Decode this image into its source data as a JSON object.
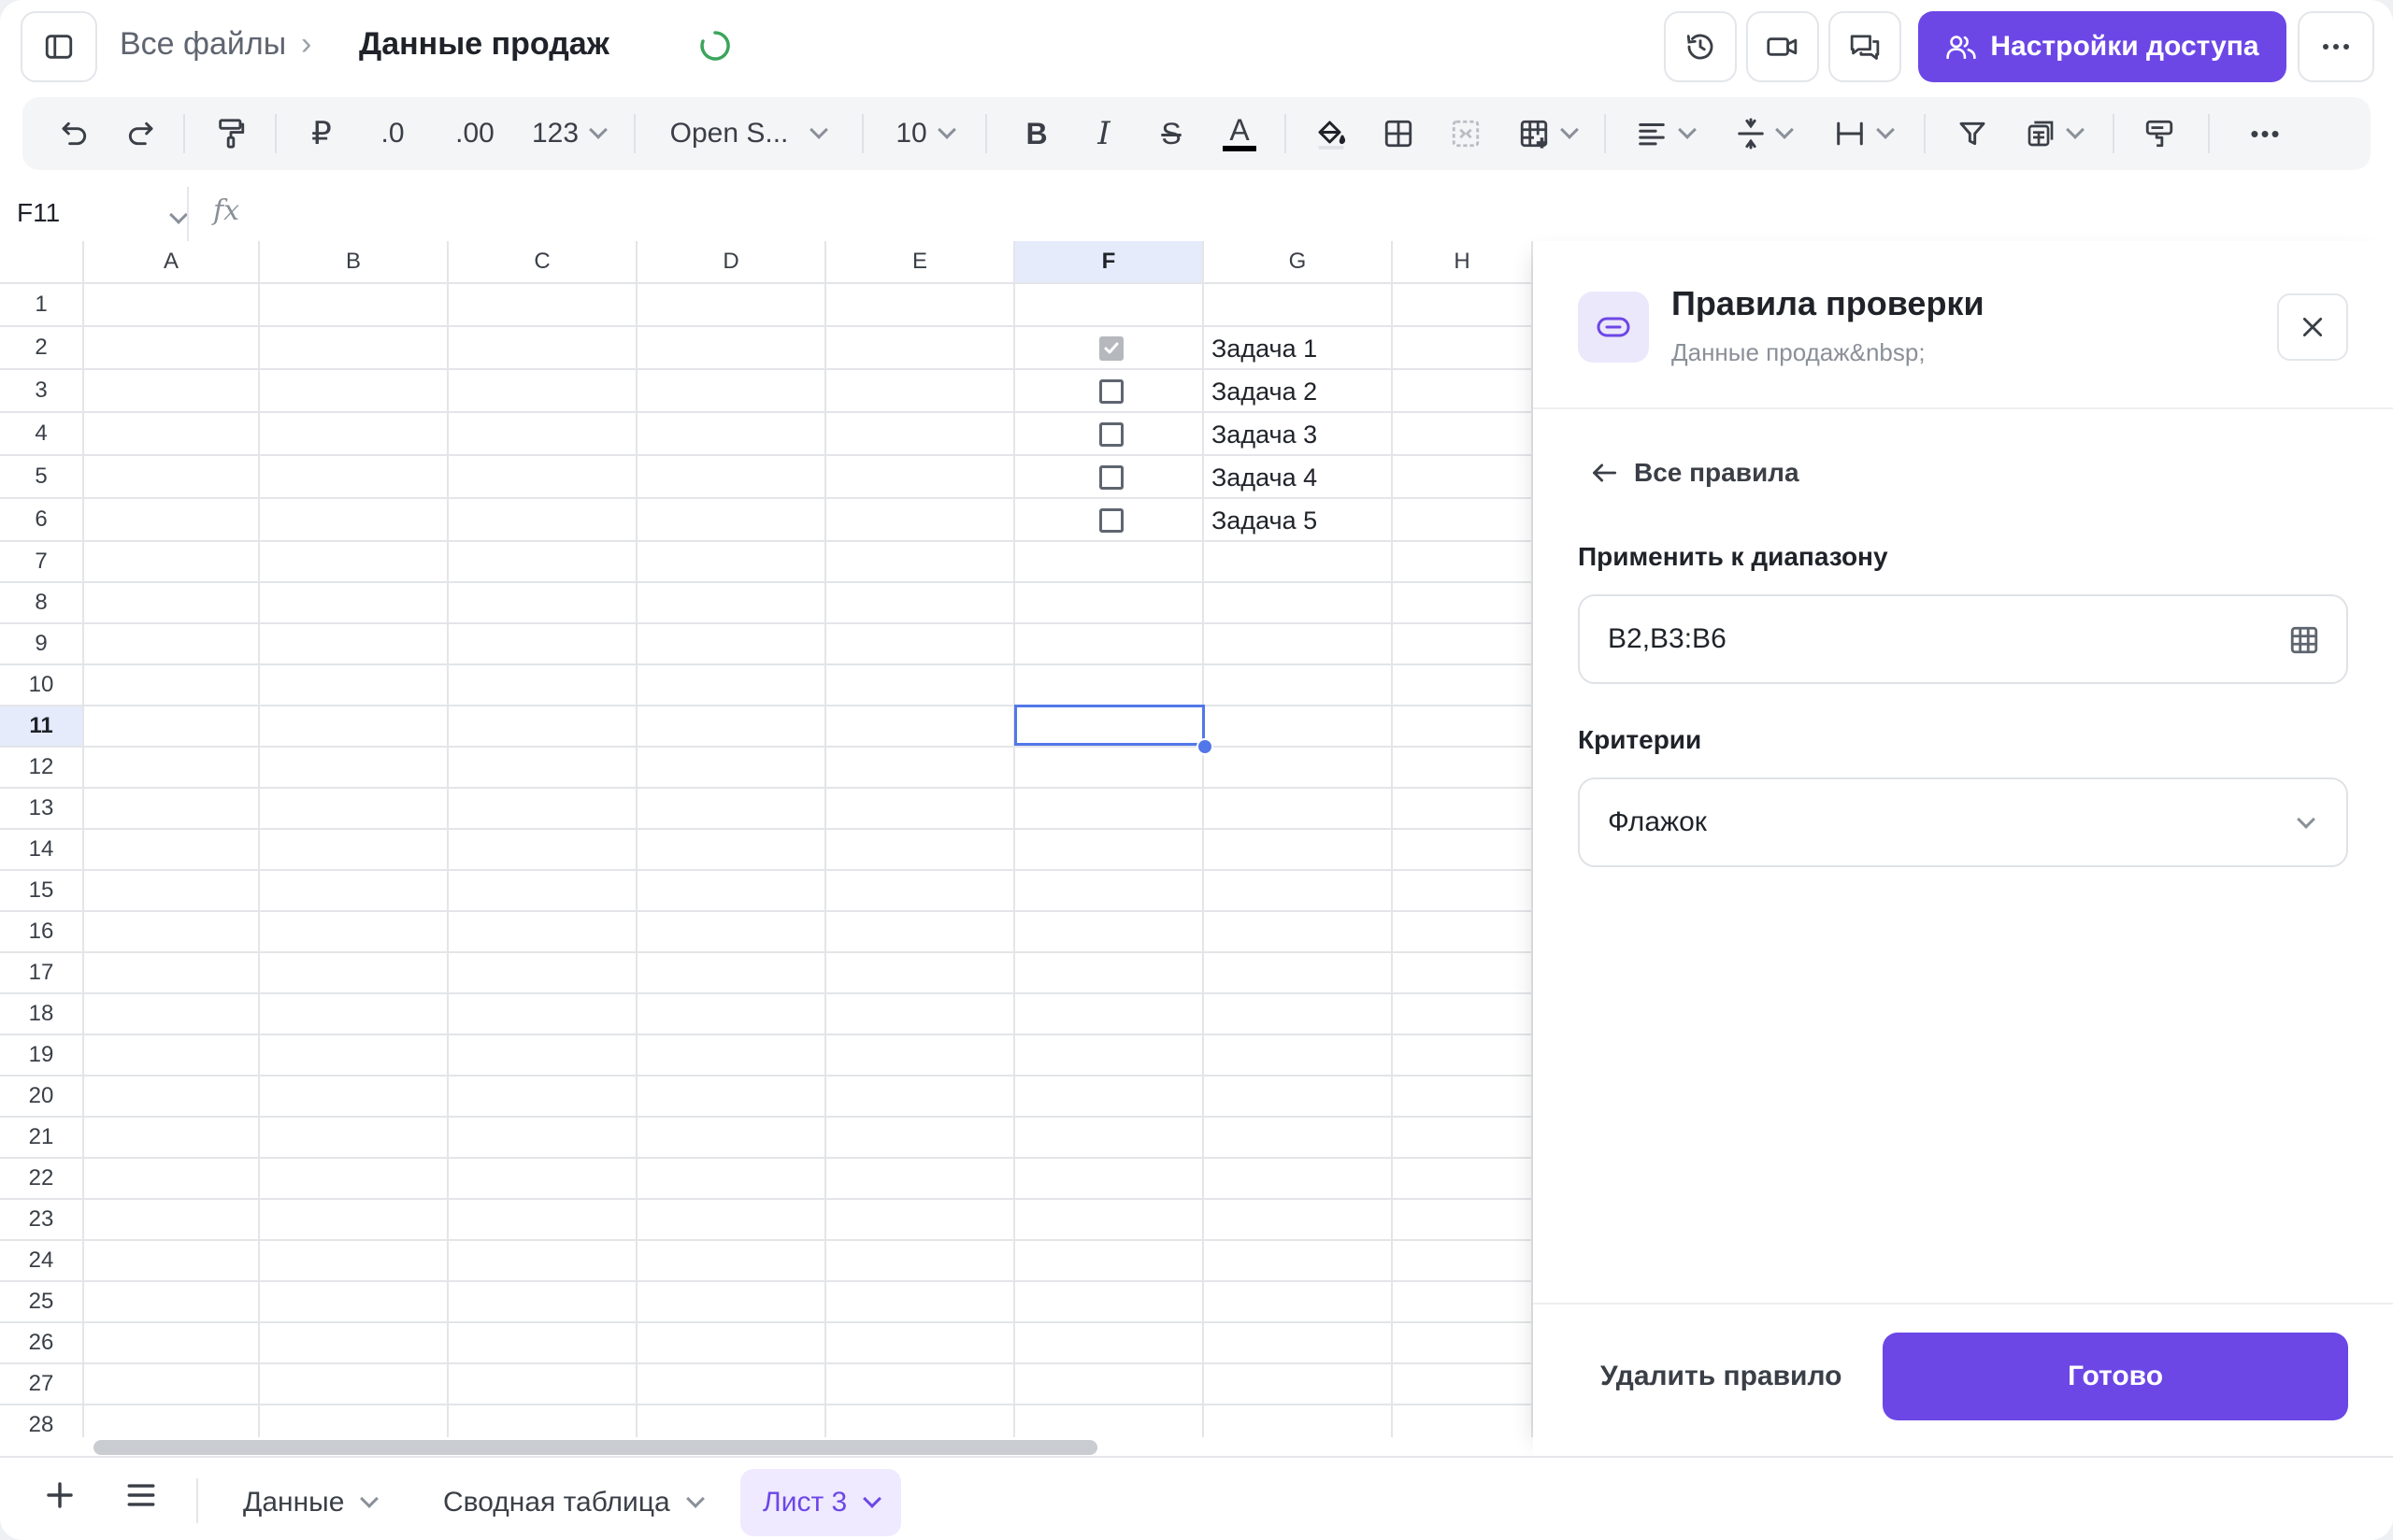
{
  "header": {
    "breadcrumb_root": "Все файлы",
    "breadcrumb_sep": "›",
    "document_title": "Данные продаж",
    "share_button": "Настройки доступа",
    "icons": [
      "sidebar-toggle-icon",
      "history-icon",
      "video-icon",
      "comments-icon",
      "more-icon"
    ]
  },
  "toolbar": {
    "currency": "₽",
    "decrease_decimals": ".0",
    "increase_decimals": ".00",
    "number_format": "123",
    "font": "Open S...",
    "font_size": "10",
    "bold": "B",
    "italic": "I",
    "strike": "S",
    "text_color": "A",
    "more": "•••"
  },
  "formula_bar": {
    "cell_ref": "F11",
    "fx": "fx",
    "value": ""
  },
  "sheet": {
    "columns": [
      "A",
      "B",
      "C",
      "D",
      "E",
      "F",
      "G",
      "H"
    ],
    "selected_column": "F",
    "rows": [
      "1",
      "2",
      "3",
      "4",
      "5",
      "6",
      "7",
      "8",
      "9",
      "10",
      "11",
      "12",
      "13",
      "14",
      "15",
      "16",
      "17",
      "18",
      "19",
      "20",
      "21",
      "22",
      "23",
      "24",
      "25",
      "26",
      "27",
      "28"
    ],
    "selected_row": "11",
    "checkboxes": [
      {
        "row": "2",
        "checked": true
      },
      {
        "row": "3",
        "checked": false
      },
      {
        "row": "4",
        "checked": false
      },
      {
        "row": "5",
        "checked": false
      },
      {
        "row": "6",
        "checked": false
      }
    ],
    "tasks": [
      "Задача 1",
      "Задача 2",
      "Задача 3",
      "Задача 4",
      "Задача 5"
    ]
  },
  "panel": {
    "title": "Правила проверки",
    "subtitle": "Данные продаж&nbsp;",
    "back_link": "Все правила",
    "range_label": "Применить к диапазону",
    "range_value": "B2,B3:B6",
    "criteria_label": "Критерии",
    "criteria_value": "Флажок",
    "delete_button": "Удалить правило",
    "done_button": "Готово"
  },
  "tabs": {
    "items": [
      "Данные",
      "Сводная таблица",
      "Лист 3"
    ],
    "active": "Лист 3"
  },
  "colors": {
    "accent": "#6c47e6",
    "selection": "#5277e8",
    "header_highlight": "#e6ebfb"
  }
}
